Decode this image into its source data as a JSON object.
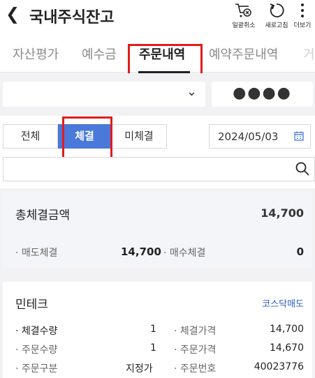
{
  "header": {
    "back_icon": "chevron-left-icon",
    "title": "국내주식잔고",
    "buttons": [
      {
        "label": "일괄취소",
        "icon": "cart-cancel-icon"
      },
      {
        "label": "새로고침",
        "icon": "refresh-icon"
      },
      {
        "label": "더보기",
        "icon": "more-vertical-icon"
      }
    ]
  },
  "tabs": [
    {
      "label": "자산평가",
      "active": false
    },
    {
      "label": "예수금",
      "active": false
    },
    {
      "label": "주문내역",
      "active": true
    },
    {
      "label": "예약주문내역",
      "active": false
    },
    {
      "label": "거",
      "active": false
    }
  ],
  "account": {
    "select_value": "",
    "masked": "●●●●"
  },
  "filter": {
    "segments": [
      {
        "label": "전체",
        "active": false
      },
      {
        "label": "체결",
        "active": true
      },
      {
        "label": "미체결",
        "active": false
      }
    ],
    "date": "2024/05/03",
    "search_placeholder": ""
  },
  "summary": {
    "total_label": "총체결금액",
    "total_value": "14,700",
    "sell_label": "· 매도체결",
    "sell_value": "14,700",
    "buy_label": "· 매수체결",
    "buy_value": "0"
  },
  "order": {
    "name": "민테크",
    "type_tag": "코스닥매도",
    "rows": [
      {
        "l1": "· 체결수량",
        "v1": "1",
        "l2": "· 체결가격",
        "v2": "14,700"
      },
      {
        "l1": "· 주문수량",
        "v1": "1",
        "l2": "· 주문가격",
        "v2": "14,670"
      },
      {
        "l1": "· 주문구분",
        "v1": "지정가",
        "l2": "· 주문번호",
        "v2": "40023776"
      }
    ]
  },
  "colors": {
    "accent": "#4a79d9",
    "highlight": "#e31b1b",
    "link": "#2b59c3"
  }
}
